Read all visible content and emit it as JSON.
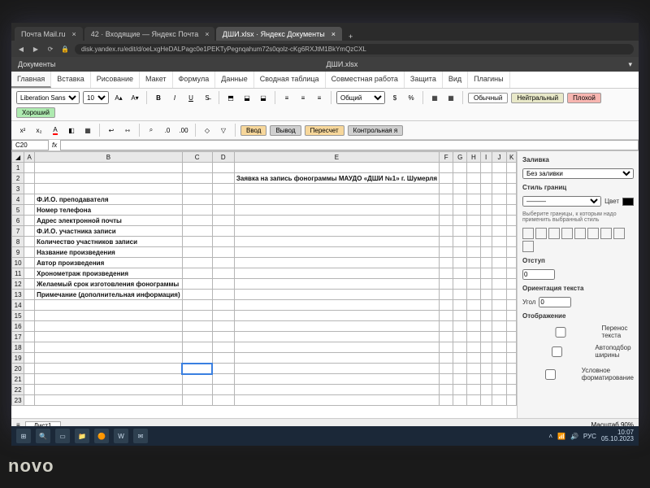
{
  "browser": {
    "tabs": [
      {
        "label": "Почта Mail.ru"
      },
      {
        "label": "42 · Входящие — Яндекс Почта"
      },
      {
        "label": "ДШИ.xlsx · Яндекс Документы",
        "active": true
      }
    ],
    "url": "disk.yandex.ru/edit/d/oeLxgHeDALPagc0e1PEKTyPegnqahum72s0qolz-cKg6RXJtM1BkYmQzCXL"
  },
  "doc": {
    "app_left": "Документы",
    "filename": "ДШИ.xlsx"
  },
  "menu": {
    "items": [
      "Главная",
      "Вставка",
      "Рисование",
      "Макет",
      "Формула",
      "Данные",
      "Сводная таблица",
      "Совместная работа",
      "Защита",
      "Вид",
      "Плагины"
    ],
    "active": "Главная"
  },
  "toolbar": {
    "font_name": "Liberation Sans",
    "font_size": "10",
    "number_format": "Общий",
    "styles": {
      "normal": "Обычный",
      "neutral": "Нейтральный",
      "bad": "Плохой",
      "good": "Хороший",
      "input": "Ввод",
      "output": "Вывод",
      "recalc": "Пересчет",
      "check": "Контрольная я"
    }
  },
  "cellref": {
    "name": "C20",
    "formula": ""
  },
  "sheet": {
    "columns": [
      "A",
      "B",
      "C",
      "D",
      "E",
      "F",
      "G",
      "H",
      "I",
      "J",
      "K"
    ],
    "title_row": 2,
    "title_col": "E",
    "title": "Заявка на запись фонограммы МАУДО «ДШИ №1» г. Шумерля",
    "labels": [
      {
        "row": 4,
        "text": "Ф.И.О. преподавателя"
      },
      {
        "row": 5,
        "text": "Номер телефона"
      },
      {
        "row": 6,
        "text": "Адрес электронной почты"
      },
      {
        "row": 7,
        "text": "Ф.И.О. участника записи"
      },
      {
        "row": 8,
        "text": "Количество участников записи"
      },
      {
        "row": 9,
        "text": "Название произведения"
      },
      {
        "row": 10,
        "text": "Автор произведения"
      },
      {
        "row": 11,
        "text": "Хронометраж произведения"
      },
      {
        "row": 12,
        "text": "Желаемый срок изготовления фонограммы"
      },
      {
        "row": 13,
        "text": "Примечание (дополнительная информация)"
      }
    ],
    "total_rows": 23,
    "cursor": {
      "row": 20,
      "col": "C"
    }
  },
  "side": {
    "fill_title": "Заливка",
    "fill_value": "Без заливки",
    "border_title": "Стиль границ",
    "border_hint": "Выберите границы, к которым надо применить выбранный стиль",
    "color_label": "Цвет",
    "indent_title": "Отступ",
    "indent_value": "0",
    "orient_title": "Ориентация текста",
    "angle_label": "Угол",
    "angle_value": "0",
    "display_title": "Отображение",
    "wrap_label": "Перенос текста",
    "autofit_label": "Автоподбор ширины",
    "cond_label": "Условное форматирование"
  },
  "sheet_tabs": {
    "sheet1": "Лист1",
    "zoom": "Масштаб 90%"
  },
  "taskbar": {
    "lang": "РУС",
    "time": "10:07",
    "date": "05.10.2023"
  },
  "laptop": "novo"
}
